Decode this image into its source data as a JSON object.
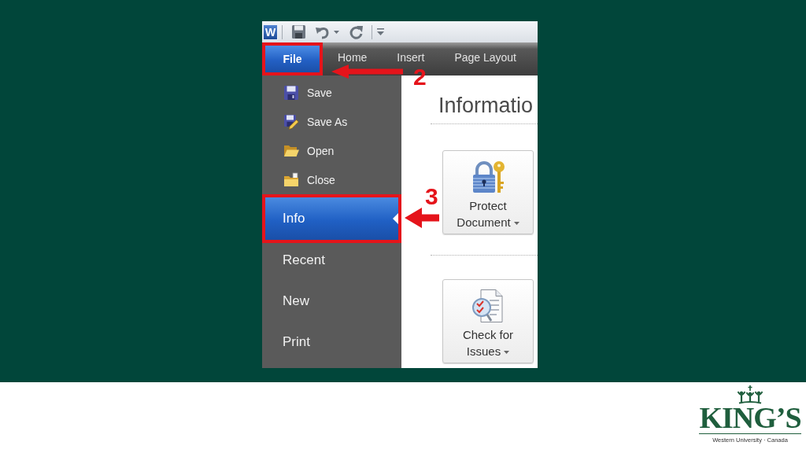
{
  "screenshot": {
    "quick_access_toolbar": {
      "app_icon": "W"
    },
    "ribbon_tabs": [
      {
        "label": "File",
        "selected": true,
        "highlighted": true
      },
      {
        "label": "Home",
        "selected": false,
        "highlighted": false
      },
      {
        "label": "Insert",
        "selected": false,
        "highlighted": false
      },
      {
        "label": "Page Layout",
        "selected": false,
        "highlighted": false
      }
    ],
    "backstage_menu": [
      {
        "label": "Save",
        "kind": "command",
        "selected": false,
        "highlighted": false
      },
      {
        "label": "Save As",
        "kind": "command",
        "selected": false,
        "highlighted": false
      },
      {
        "label": "Open",
        "kind": "command",
        "selected": false,
        "highlighted": false
      },
      {
        "label": "Close",
        "kind": "command",
        "selected": false,
        "highlighted": false
      },
      {
        "label": "Info",
        "kind": "page",
        "selected": true,
        "highlighted": true
      },
      {
        "label": "Recent",
        "kind": "page",
        "selected": false,
        "highlighted": false
      },
      {
        "label": "New",
        "kind": "page",
        "selected": false,
        "highlighted": false
      },
      {
        "label": "Print",
        "kind": "page",
        "selected": false,
        "highlighted": false
      }
    ],
    "info_pane": {
      "title": "Informatio",
      "actions": [
        {
          "label": "Protect Document",
          "dropdown": true
        },
        {
          "label": "Check for Issues",
          "dropdown": true
        }
      ]
    },
    "annotations": [
      {
        "number": "2"
      },
      {
        "number": "3"
      }
    ]
  },
  "footer": {
    "logo": {
      "wordmark": "KING’S",
      "tagline": "Western University · Canada"
    }
  }
}
